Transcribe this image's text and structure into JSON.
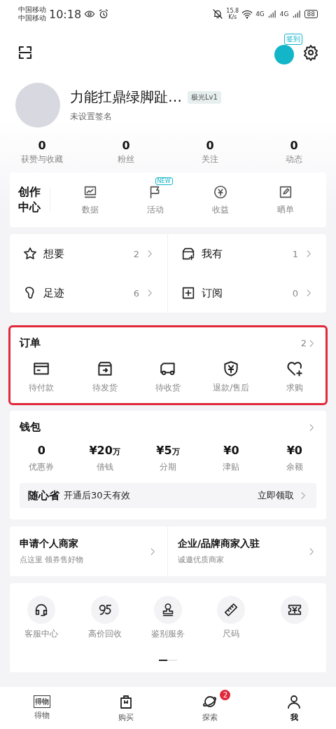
{
  "status_bar": {
    "carriers": [
      "中国移动",
      "中国移动"
    ],
    "time": "10:18",
    "speed": "15.8",
    "speed_unit": "K/s",
    "network": [
      "4G",
      "4G"
    ],
    "battery": "88"
  },
  "header": {
    "checkin_badge": "签到"
  },
  "profile": {
    "name": "力能扛鼎绿脚趾…",
    "level": "极光Lv1",
    "signature": "未设置签名"
  },
  "stats": [
    {
      "value": "0",
      "label": "获赞与收藏"
    },
    {
      "value": "0",
      "label": "粉丝"
    },
    {
      "value": "0",
      "label": "关注"
    },
    {
      "value": "0",
      "label": "动态"
    }
  ],
  "creator": {
    "title": "创作中心",
    "items": [
      {
        "kind": "chart",
        "label": "数据"
      },
      {
        "kind": "flag",
        "label": "活动",
        "badge": "NEW"
      },
      {
        "kind": "yuan",
        "label": "收益"
      },
      {
        "kind": "edit",
        "label": "晒单"
      }
    ]
  },
  "shortcuts": [
    {
      "kind": "star",
      "label": "想要",
      "count": "2"
    },
    {
      "kind": "box",
      "label": "我有",
      "count": "1"
    },
    {
      "kind": "foot",
      "label": "足迹",
      "count": "6"
    },
    {
      "kind": "plus",
      "label": "订阅",
      "count": "0"
    }
  ],
  "orders": {
    "title": "订单",
    "count": "2",
    "highlighted": true,
    "items": [
      {
        "kind": "card",
        "label": "待付款"
      },
      {
        "kind": "parcel",
        "label": "待发货"
      },
      {
        "kind": "truck",
        "label": "待收货"
      },
      {
        "kind": "shield",
        "label": "退款/售后"
      },
      {
        "kind": "heart",
        "label": "求购"
      }
    ]
  },
  "wallet": {
    "title": "钱包",
    "items": [
      {
        "value": "0",
        "label": "优惠券"
      },
      {
        "value": "¥20",
        "unit": "万",
        "label": "借钱"
      },
      {
        "value": "¥5",
        "unit": "万",
        "label": "分期"
      },
      {
        "value": "¥0",
        "label": "津贴"
      },
      {
        "value": "¥0",
        "label": "余额"
      }
    ],
    "promo": {
      "brand": "随心省",
      "text": "开通后30天有效",
      "action": "立即领取"
    }
  },
  "merchants": [
    {
      "title": "申请个人商家",
      "subtitle": "点这里 领券售好物"
    },
    {
      "title": "企业/品牌商家入驻",
      "subtitle": "诚邀优质商家"
    }
  ],
  "services": [
    {
      "kind": "headset",
      "label": "客服中心"
    },
    {
      "kind": "recycle",
      "label": "高价回收"
    },
    {
      "kind": "stamp",
      "label": "鉴别服务"
    },
    {
      "kind": "ruler",
      "label": "尺码"
    },
    {
      "kind": "ticket"
    }
  ],
  "bottom_nav": [
    {
      "kind": "logo",
      "label": "得物",
      "logo": "得物",
      "selected": false
    },
    {
      "kind": "bag",
      "label": "购买",
      "selected": false
    },
    {
      "kind": "planet",
      "label": "探索",
      "badge": "2",
      "selected": false
    },
    {
      "kind": "me",
      "label": "我",
      "selected": true
    }
  ]
}
